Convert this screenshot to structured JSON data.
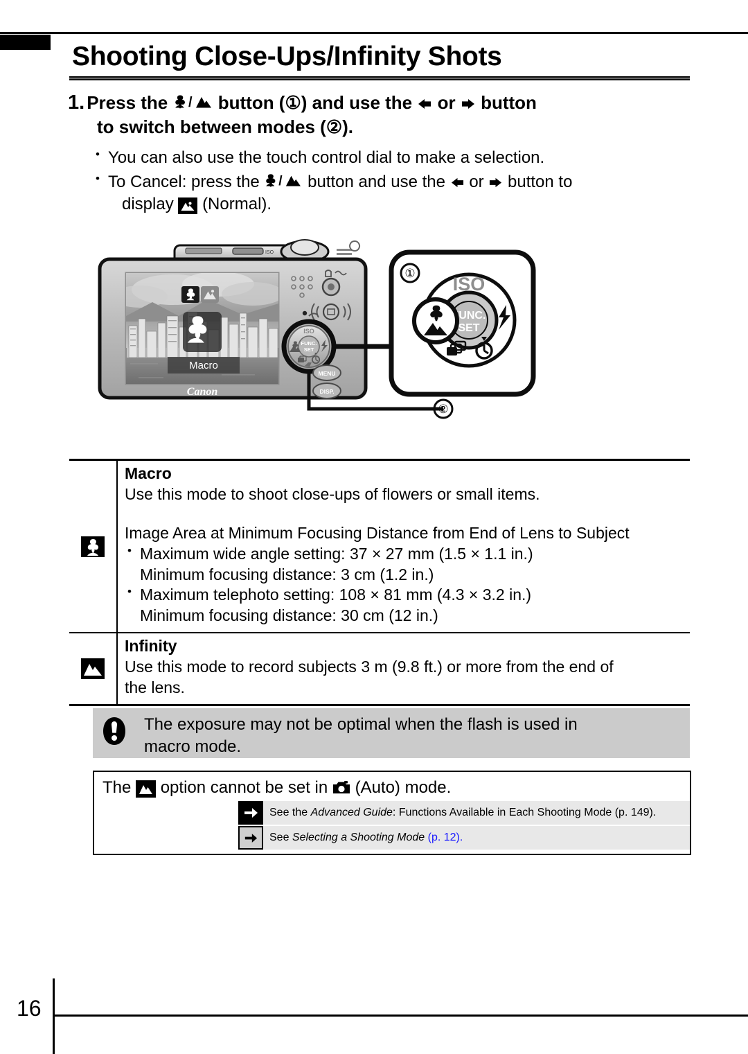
{
  "page": {
    "title": "Shooting Close-Ups/Infinity Shots",
    "folio": "16"
  },
  "step": {
    "number": "1.",
    "line1_a": "Press the",
    "line1_b": "button (①) and use the",
    "line1_c": "or",
    "line1_d": "button",
    "line2": "to switch between modes (②)."
  },
  "bullets": [
    {
      "text": "You can also use the touch control dial to make a selection."
    },
    {
      "a": "To Cancel: press the",
      "b": "button and use the",
      "c": "or",
      "d": "button to",
      "e": "display",
      "f": "(Normal)."
    }
  ],
  "figure": {
    "callout_1": "①",
    "callout_2": "②",
    "lcd_label": "Macro",
    "brand": "Canon",
    "dial_iso": "ISO",
    "dial_func": "FUNC.",
    "dial_set": "SET",
    "button_menu": "MENU",
    "button_disp": "DISP."
  },
  "modes": [
    {
      "icon": "macro-flower-icon",
      "name": "Macro",
      "description": "Use this mode to shoot close-ups of flowers or small items.",
      "spec_heading": "Image Area at Minimum Focusing Distance from End of Lens to Subject",
      "specs": [
        {
          "bullet": "Maximum wide angle setting: 37 × 27 mm (1.5 × 1.1 in.)",
          "sub": "Minimum focusing distance: 3 cm (1.2 in.)"
        },
        {
          "bullet": "Maximum telephoto setting: 108 × 81 mm (4.3 × 3.2 in.)",
          "sub": "Minimum focusing distance: 30 cm (12 in.)"
        }
      ]
    },
    {
      "icon": "infinity-mountain-icon",
      "name": "Infinity",
      "description_line1": "Use this mode to record subjects 3 m (9.8 ft.) or more from the end of",
      "description_line2": "the lens."
    }
  ],
  "caution": {
    "icon": "exclamation-warning-icon",
    "line1": "The exposure may not be optimal when the flash is used in",
    "line2": "macro mode."
  },
  "note": {
    "prefix": "The",
    "middle": "option cannot be set in",
    "suffix": "(Auto) mode.",
    "references": [
      {
        "badge": "arrow-right-dark-icon",
        "pre": "See the ",
        "italic": "Advanced Guide",
        "post": ": Functions Available in Each Shooting Mode (p. 149).",
        "page_link": ""
      },
      {
        "badge": "arrow-right-light-icon",
        "pre": "See ",
        "italic": "Selecting a Shooting Mode",
        "post": " ",
        "page_link": "(p. 12)."
      }
    ]
  },
  "colors": {
    "caution_bg": "#cbcbcb",
    "reference_bg": "#e8e8e8",
    "page_link": "#1a1aff",
    "rule": "#000000"
  }
}
